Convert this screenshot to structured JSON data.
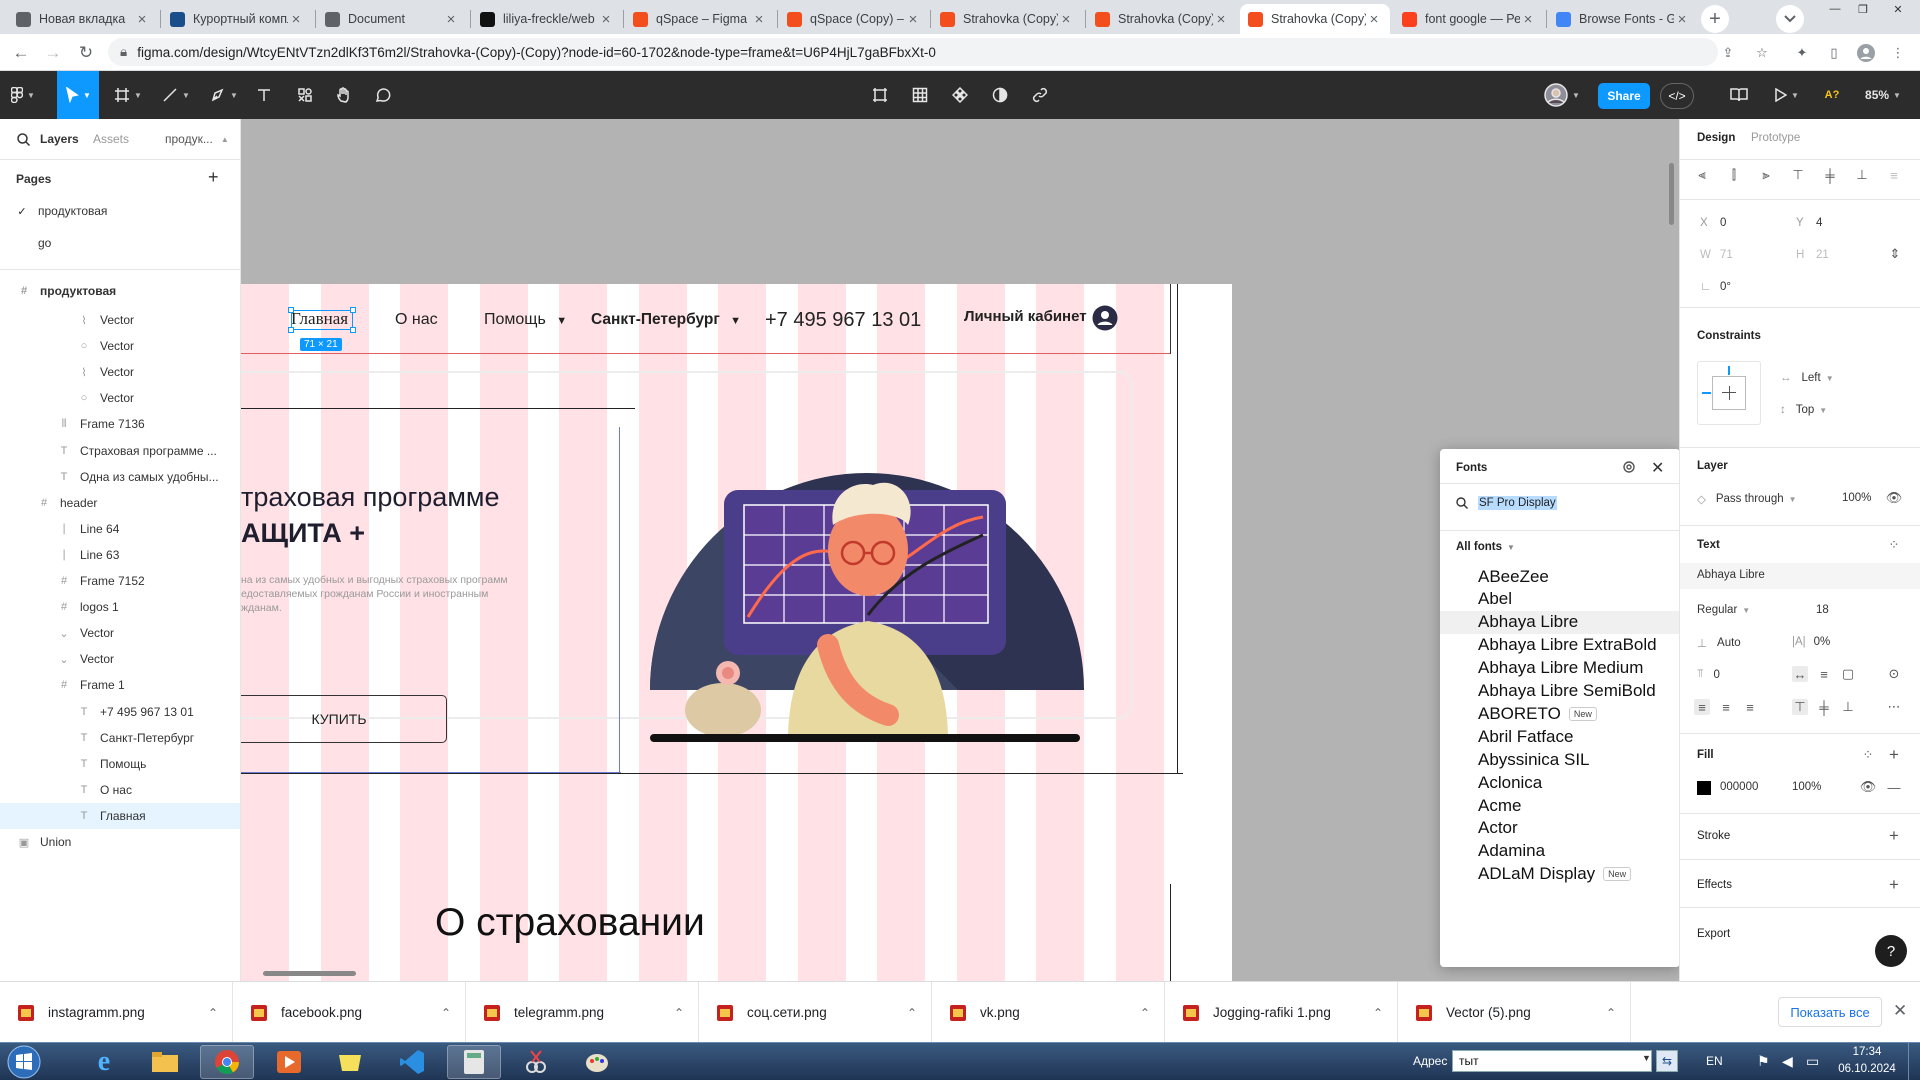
{
  "browser": {
    "tabs": [
      {
        "label": "Новая вкладка",
        "icon": "chrome-icon",
        "color": "#5f6368"
      },
      {
        "label": "Курортный комплекс",
        "icon": "site-icon",
        "color": "#1a4e8a"
      },
      {
        "label": "Document",
        "icon": "globe-icon",
        "color": "#5f6368"
      },
      {
        "label": "liliya-freckle/web",
        "icon": "github-icon",
        "color": "#111111"
      },
      {
        "label": "qSpace – Figma",
        "icon": "figma-icon",
        "color": "#f24e1e"
      },
      {
        "label": "qSpace (Copy) –",
        "icon": "figma-icon",
        "color": "#f24e1e"
      },
      {
        "label": "Strahovka (Copy)",
        "icon": "figma-icon",
        "color": "#f24e1e"
      },
      {
        "label": "Strahovka (Copy)",
        "icon": "figma-icon",
        "color": "#f24e1e"
      },
      {
        "label": "Strahovka (Copy)",
        "icon": "figma-icon",
        "color": "#f24e1e",
        "active": true
      },
      {
        "label": "font google — Ре",
        "icon": "yandex-icon",
        "color": "#fc3f1d"
      },
      {
        "label": "Browse Fonts - G",
        "icon": "google-fonts-icon",
        "color": "#4285f4"
      }
    ],
    "url": "figma.com/design/WtcyENtVTzn2dlKf3T6m2l/Strahovka-(Copy)-(Copy)?node-id=60-1702&node-type=frame&t=U6P4HjL7gaBFbxXt-0"
  },
  "toolbar": {
    "share_label": "Share",
    "zoom": "85%",
    "ai_label": "A?",
    "dev_label": "</>"
  },
  "left_panel": {
    "tabs": [
      "Layers",
      "Assets",
      "продук..."
    ],
    "pages_label": "Pages",
    "pages": [
      "продуктовая",
      "go"
    ],
    "current_page": "продуктовая",
    "layers": [
      {
        "name": "Vector",
        "icon": "vector-icon",
        "indent": 3
      },
      {
        "name": "Vector",
        "icon": "ellipse-icon",
        "indent": 3
      },
      {
        "name": "Vector",
        "icon": "vector-icon",
        "indent": 3
      },
      {
        "name": "Vector",
        "icon": "ellipse-icon",
        "indent": 3
      },
      {
        "name": "Frame 7136",
        "icon": "auto-layout-icon",
        "indent": 2
      },
      {
        "name": "Страховая программе ...",
        "icon": "text-icon",
        "indent": 2
      },
      {
        "name": "Одна из самых удобны...",
        "icon": "text-icon",
        "indent": 2
      },
      {
        "name": "header",
        "icon": "frame-icon",
        "indent": 1
      },
      {
        "name": "Line 64",
        "icon": "line-icon",
        "indent": 2
      },
      {
        "name": "Line 63",
        "icon": "line-icon",
        "indent": 2
      },
      {
        "name": "Frame 7152",
        "icon": "frame-icon",
        "indent": 2
      },
      {
        "name": "logos 1",
        "icon": "frame-icon",
        "indent": 2
      },
      {
        "name": "Vector",
        "icon": "chevron-down-icon",
        "indent": 2
      },
      {
        "name": "Vector",
        "icon": "chevron-down-icon",
        "indent": 2
      },
      {
        "name": "Frame 1",
        "icon": "frame-icon",
        "indent": 2
      },
      {
        "name": "+7 495 967 13 01",
        "icon": "text-icon",
        "indent": 3
      },
      {
        "name": "Санкт-Петербург",
        "icon": "text-icon",
        "indent": 3
      },
      {
        "name": "Помощь",
        "icon": "text-icon",
        "indent": 3
      },
      {
        "name": "О нас",
        "icon": "text-icon",
        "indent": 3
      },
      {
        "name": "Главная",
        "icon": "text-icon",
        "indent": 3,
        "selected": true
      },
      {
        "name": "Union",
        "icon": "union-icon",
        "indent": 0
      }
    ]
  },
  "canvas": {
    "nav": {
      "home": "Главная",
      "about": "О нас",
      "help": "Помощь",
      "city": "Санкт-Петербург",
      "phone": "+7 495 967 13 01",
      "account": "Личный кабинет"
    },
    "selection_size": "71 × 21",
    "hero": {
      "title_line1": "траховая программе",
      "title_line2": "АЩИТА +",
      "description": "на из самых удобных и выгодных страховых программ\nедоставляемых грожданам России и иностранным\nжданам.",
      "buy_button": "КУПИТЬ"
    },
    "section_title": "О страховании"
  },
  "fonts_popup": {
    "title": "Fonts",
    "search_value": "SF Pro Display",
    "filter": "All fonts",
    "fonts": [
      {
        "name": "ABeeZee"
      },
      {
        "name": "Abel"
      },
      {
        "name": "Abhaya Libre",
        "highlighted": true
      },
      {
        "name": "Abhaya Libre ExtraBold"
      },
      {
        "name": "Abhaya Libre Medium"
      },
      {
        "name": "Abhaya Libre SemiBold"
      },
      {
        "name": "ABORETO",
        "badge": "New"
      },
      {
        "name": "Abril Fatface"
      },
      {
        "name": "Abyssinica SIL"
      },
      {
        "name": "Aclonica"
      },
      {
        "name": "Acme"
      },
      {
        "name": "Actor"
      },
      {
        "name": "Adamina"
      },
      {
        "name": "ADLaM Display",
        "badge": "New"
      }
    ]
  },
  "right_panel": {
    "tabs": [
      "Design",
      "Prototype"
    ],
    "x": "0",
    "y": "4",
    "w": "71",
    "h": "21",
    "rotation": "0°",
    "constraints_label": "Constraints",
    "constraint_h": "Left",
    "constraint_v": "Top",
    "layer_label": "Layer",
    "blend": "Pass through",
    "opacity": "100%",
    "text_label": "Text",
    "font_family": "Abhaya Libre",
    "font_weight": "Regular",
    "font_size": "18",
    "line_height": "Auto",
    "letter_spacing": "0%",
    "paragraph_spacing": "0",
    "fill_label": "Fill",
    "fill_hex": "000000",
    "fill_opacity": "100%",
    "stroke_label": "Stroke",
    "effects_label": "Effects",
    "export_label": "Export",
    "help": "?"
  },
  "downloads": {
    "items": [
      "instagramm.png",
      "facebook.png",
      "telegramm.png",
      "соц.сети.png",
      "vk.png",
      "Jogging-rafiki 1.png",
      "Vector (5).png"
    ],
    "show_all": "Показать все"
  },
  "taskbar": {
    "address_label": "Адрес",
    "address_value": "тыт",
    "lang": "EN",
    "time": "17:34",
    "date": "06.10.2024"
  },
  "colors": {
    "figma_blue": "#0d99ff",
    "toolbar_dark": "#2c2c2c",
    "stripe_pink": "#ff788c",
    "selection_blue": "#0d99ff",
    "fill_color": "#000000"
  }
}
